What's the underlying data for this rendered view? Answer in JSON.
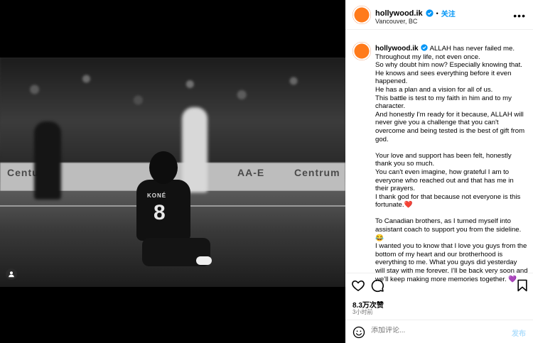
{
  "post": {
    "username": "hollywood.ik",
    "follow_label": "关注",
    "location": "Vancouver, BC",
    "photo_text": {
      "jersey_name": "KONÉ",
      "jersey_number": "8",
      "board_left": "Centuri",
      "board_mid": "AA-E",
      "board_right": "Centrum"
    },
    "caption": {
      "line1": "ALLAH has never failed me.",
      "body": "Throughout my life, not even once.\nSo why doubt him now? Especially knowing that. He knows and sees everything before it even happened.\nHe has a plan and a vision for all of us.\nThis battle is test to my faith in him and to my character.\nAnd honestly I'm ready for it because, ALLAH will never give you a challenge that you can't overcome and being tested is the best of gift from god.\n\nYour love and support has been felt, honestly thank you so much.\nYou can't even imagine, how grateful I am to everyone who reached out and that has me in their prayers.\nI thank god for that because not everyone is this fortunate.❤️\n\nTo Canadian brothers, as I turned myself into assistant coach to support you from the sideline.😂\nI wanted you to know that I love you guys from the bottom of my heart and our brotherhood is everything to me. What you guys did yesterday will stay with me forever. I'll be back very soon and we'll keep making more memories together. 💜"
    },
    "likes": "8.3万次赞",
    "time_ago": "3小时前",
    "comment_placeholder": "添加评论...",
    "post_label": "发布"
  },
  "icons": {
    "verified": "verified-badge-icon",
    "more": "more-options-icon",
    "like": "heart-icon",
    "comment": "comment-icon",
    "save": "bookmark-icon",
    "emoji": "emoji-icon",
    "tag": "user-tag-icon"
  },
  "colors": {
    "accent": "#0095f6",
    "avatar": "#ff7a1a",
    "post_disabled": "#b2dffc"
  }
}
